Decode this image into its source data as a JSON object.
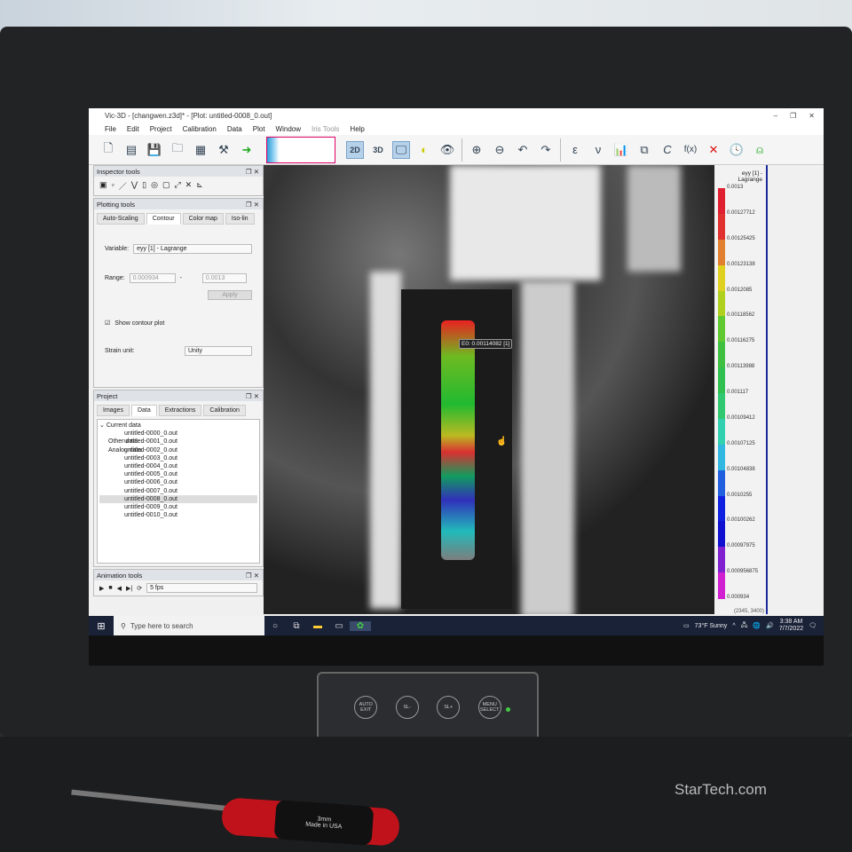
{
  "window": {
    "title": "Vic-3D - [changwen.z3d]* - [Plot: untitled-0008_0.out]",
    "controls": [
      "–",
      "❐",
      "✕"
    ]
  },
  "menu": [
    "File",
    "Edit",
    "Project",
    "Calibration",
    "Data",
    "Plot",
    "Window",
    "Iris Tools",
    "Help"
  ],
  "toolbar": {
    "view2d": "2D",
    "view3d": "3D",
    "epsilon": "ε",
    "nu": "ν",
    "c": "C",
    "fx": "f(x)"
  },
  "inspector": {
    "title": "Inspector tools"
  },
  "plotting": {
    "title": "Plotting tools",
    "tabs": [
      "Auto-Scaling",
      "Contour",
      "Color map",
      "Iso-lin"
    ],
    "variable_label": "Variable:",
    "variable": "eyy [1] - Lagrange",
    "range_label": "Range:",
    "range_min": "0.000934",
    "range_dash": "-",
    "range_max": "0.0013",
    "apply": "Apply",
    "show_contour": "Show contour plot",
    "strain_unit_label": "Strain unit:",
    "strain_unit": "Unity"
  },
  "project": {
    "title": "Project",
    "tabs": [
      "Images",
      "Data",
      "Extractions",
      "Calibration"
    ],
    "root": "Current data",
    "files": [
      "untitled-0000_0.out",
      "untitled-0001_0.out",
      "untitled-0002_0.out",
      "untitled-0003_0.out",
      "untitled-0004_0.out",
      "untitled-0005_0.out",
      "untitled-0006_0.out",
      "untitled-0007_0.out",
      "untitled-0008_0.out",
      "untitled-0009_0.out",
      "untitled-0010_0.out"
    ],
    "selected_index": 8,
    "other": "Other data",
    "analog": "Analog data"
  },
  "animation": {
    "title": "Animation tools",
    "fps": "5 fps"
  },
  "plot": {
    "tooltip": "E0: 0.00114082 [1]",
    "coords": "(2345, 3400)"
  },
  "colorbar": {
    "title": "eyy [1] - Lagrange",
    "labels": [
      "0.0013",
      "0.00127712",
      "0.00125425",
      "0.00123138",
      "0.0012085",
      "0.00118562",
      "0.00116275",
      "0.00113988",
      "0.001117",
      "0.00109412",
      "0.00107125",
      "0.00104838",
      "0.0010255",
      "0.00100262",
      "0.00097975",
      "0.000956875",
      "0.000934"
    ],
    "colors": [
      "#e02030",
      "#e03030",
      "#e08030",
      "#e0d020",
      "#b0d020",
      "#60c830",
      "#40c040",
      "#30c050",
      "#30c870",
      "#30d0b0",
      "#30b8e0",
      "#2060e0",
      "#1020e0",
      "#1010d0",
      "#8020d0",
      "#d020d0"
    ]
  },
  "taskbar": {
    "search": "Type here to search",
    "weather": "73°F  Sunny",
    "time": "3:38 AM",
    "date": "7/7/2022"
  },
  "monitor": {
    "buttons": [
      "AUTO EXIT",
      "SL-",
      "SL+",
      "MENU SELECT"
    ],
    "brand": "StarTech.com"
  },
  "screwdriver": {
    "size": "3mm",
    "made": "Made in USA"
  }
}
